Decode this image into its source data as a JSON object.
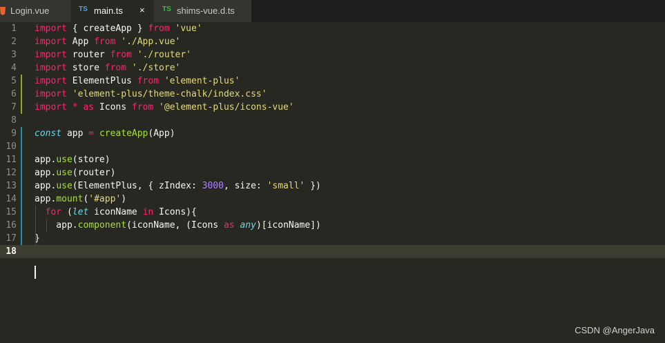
{
  "tabs": [
    {
      "label": "Login.vue",
      "icon": "html5-icon"
    },
    {
      "label": "main.ts",
      "icon_text": "TS",
      "active": true,
      "close": "×"
    },
    {
      "label": "shims-vue.d.ts",
      "icon_text": "TS"
    }
  ],
  "line_numbers": [
    "1",
    "2",
    "3",
    "4",
    "5",
    "6",
    "7",
    "8",
    "9",
    "10",
    "11",
    "12",
    "13",
    "14",
    "15",
    "16",
    "17",
    "18"
  ],
  "code": [
    [
      [
        "k",
        "import"
      ],
      [
        "p",
        " { createApp } "
      ],
      [
        "k",
        "from"
      ],
      [
        "p",
        " "
      ],
      [
        "s",
        "'vue'"
      ]
    ],
    [
      [
        "k",
        "import"
      ],
      [
        "p",
        " App "
      ],
      [
        "k",
        "from"
      ],
      [
        "p",
        " "
      ],
      [
        "s",
        "'./App.vue'"
      ]
    ],
    [
      [
        "k",
        "import"
      ],
      [
        "p",
        " router "
      ],
      [
        "k",
        "from"
      ],
      [
        "p",
        " "
      ],
      [
        "s",
        "'./router'"
      ]
    ],
    [
      [
        "k",
        "import"
      ],
      [
        "p",
        " store "
      ],
      [
        "k",
        "from"
      ],
      [
        "p",
        " "
      ],
      [
        "s",
        "'./store'"
      ]
    ],
    [
      [
        "k",
        "import"
      ],
      [
        "p",
        " ElementPlus "
      ],
      [
        "k",
        "from"
      ],
      [
        "p",
        " "
      ],
      [
        "s",
        "'element-plus'"
      ]
    ],
    [
      [
        "k",
        "import"
      ],
      [
        "p",
        " "
      ],
      [
        "s",
        "'element-plus/theme-chalk/index.css'"
      ]
    ],
    [
      [
        "k",
        "import"
      ],
      [
        "p",
        " "
      ],
      [
        "k",
        "*"
      ],
      [
        "p",
        " "
      ],
      [
        "k",
        "as"
      ],
      [
        "p",
        " Icons "
      ],
      [
        "k",
        "from"
      ],
      [
        "p",
        " "
      ],
      [
        "s",
        "'@element-plus/icons-vue'"
      ]
    ],
    [],
    [
      [
        "t",
        "const"
      ],
      [
        "p",
        " app "
      ],
      [
        "k",
        "="
      ],
      [
        "p",
        " "
      ],
      [
        "f",
        "createApp"
      ],
      [
        "p",
        "(App)"
      ]
    ],
    [],
    [
      [
        "p",
        "app."
      ],
      [
        "f",
        "use"
      ],
      [
        "p",
        "(store)"
      ]
    ],
    [
      [
        "p",
        "app."
      ],
      [
        "f",
        "use"
      ],
      [
        "p",
        "(router)"
      ]
    ],
    [
      [
        "p",
        "app."
      ],
      [
        "f",
        "use"
      ],
      [
        "p",
        "(ElementPlus, { zIndex: "
      ],
      [
        "n",
        "3000"
      ],
      [
        "p",
        ", size: "
      ],
      [
        "s",
        "'small'"
      ],
      [
        "p",
        " })"
      ]
    ],
    [
      [
        "p",
        "app."
      ],
      [
        "f",
        "mount"
      ],
      [
        "p",
        "("
      ],
      [
        "s",
        "'#app'"
      ],
      [
        "p",
        ")"
      ]
    ],
    [
      [
        "p",
        "  "
      ],
      [
        "k",
        "for"
      ],
      [
        "p",
        " ("
      ],
      [
        "t",
        "let"
      ],
      [
        "p",
        " iconName "
      ],
      [
        "k",
        "in"
      ],
      [
        "p",
        " Icons){"
      ]
    ],
    [
      [
        "p",
        "    app."
      ],
      [
        "f",
        "component"
      ],
      [
        "p",
        "(iconName, (Icons "
      ],
      [
        "k",
        "as"
      ],
      [
        "p",
        " "
      ],
      [
        "t",
        "any"
      ],
      [
        "p",
        ")[iconName])"
      ]
    ],
    [
      [
        "p",
        "}"
      ]
    ],
    []
  ],
  "watermark": "CSDN @AngerJava",
  "colors": {
    "background": "#272822",
    "keyword": "#f92672",
    "string": "#e6db74",
    "function": "#a6e22e",
    "storage": "#66d9ef",
    "number": "#ae81ff",
    "ts_icon_blue": "#4fa3e0",
    "ts_icon_green": "#3fb950"
  }
}
